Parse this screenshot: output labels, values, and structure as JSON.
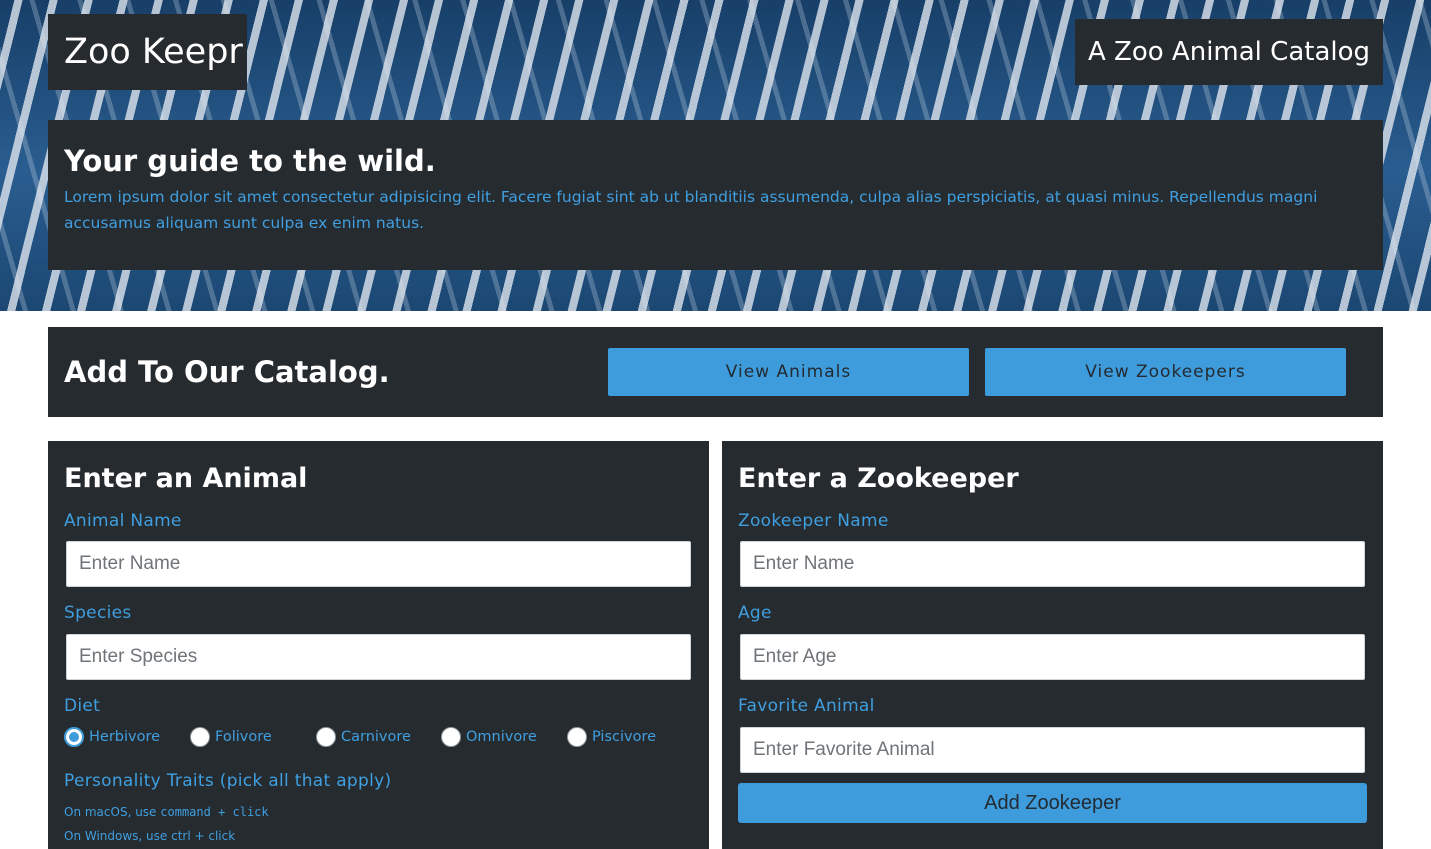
{
  "header": {
    "brand": "Zoo Keepr",
    "tagline": "A Zoo Animal Catalog"
  },
  "hero": {
    "title": "Your guide to the wild.",
    "text": "Lorem ipsum dolor sit amet consectetur adipisicing elit. Facere fugiat sint ab ut blanditiis assumenda, culpa alias perspiciatis, at quasi minus. Repellendus magni accusamus aliquam sunt culpa ex enim natus."
  },
  "catalog": {
    "title": "Add To Our Catalog.",
    "view_animals": "View Animals",
    "view_zookeepers": "View Zookeepers"
  },
  "animal_form": {
    "title": "Enter an Animal",
    "name_label": "Animal Name",
    "name_placeholder": "Enter Name",
    "species_label": "Species",
    "species_placeholder": "Enter Species",
    "diet_label": "Diet",
    "diet_options": [
      {
        "label": "Herbivore",
        "checked": true
      },
      {
        "label": "Folivore",
        "checked": false
      },
      {
        "label": "Carnivore",
        "checked": false
      },
      {
        "label": "Omnivore",
        "checked": false
      },
      {
        "label": "Piscivore",
        "checked": false
      }
    ],
    "traits_label": "Personality Traits (pick all that apply)",
    "hint_mac_prefix": "On macOS, use ",
    "hint_mac_code": "command + click",
    "hint_windows": "On Windows, use ctrl + click"
  },
  "zookeeper_form": {
    "title": "Enter a Zookeeper",
    "name_label": "Zookeeper Name",
    "name_placeholder": "Enter Name",
    "age_label": "Age",
    "age_placeholder": "Enter Age",
    "favorite_label": "Favorite Animal",
    "favorite_placeholder": "Enter Favorite Animal",
    "submit": "Add Zookeeper"
  },
  "colors": {
    "panel": "#262b2f",
    "accent": "#3e9cdc",
    "label": "#3f9fe0",
    "hero_blue": "#1d4b78"
  }
}
